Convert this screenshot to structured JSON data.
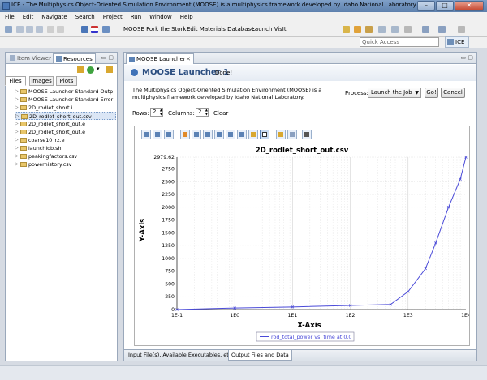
{
  "window": {
    "title": "ICE - The Multiphysics Object-Oriented Simulation Environment (MOOSE) is a multiphysics framework developed by Idaho National Laboratory. - ICE"
  },
  "menu": [
    "File",
    "Edit",
    "Navigate",
    "Search",
    "Project",
    "Run",
    "Window",
    "Help"
  ],
  "toolbar": {
    "link1": "MOOSE Fork the Stork",
    "link2": "Edit Materials Database",
    "link3": "Launch VisIt"
  },
  "quick_access": {
    "placeholder": "Quick Access"
  },
  "perspective": {
    "label": "ICE"
  },
  "left": {
    "tabs": [
      "Item Viewer",
      "Resources"
    ],
    "subtabs": [
      "Files",
      "Images",
      "Plots"
    ],
    "files": [
      "MOOSE Launcher Standard Outp",
      "MOOSE Launcher Standard Error",
      "2D_rodlet_short.i",
      "2D_rodlet_short_out.csv",
      "2D_rodlet_short_out.e",
      "2D_rodlet_short_out.e",
      "coarse10_rz.e",
      "launchlob.sh",
      "peakingfactors.csv",
      "powerhistory.csv"
    ]
  },
  "editor": {
    "tab": "MOOSE Launcher",
    "title": "MOOSE Launcher 1",
    "status": "Done!",
    "description": "The Multiphysics Object-Oriented Simulation Environment (MOOSE) is a multiphysics framework developed by Idaho National Laboratory.",
    "process_label": "Process:",
    "process_value": "Launch the Job",
    "go": "Go!",
    "cancel": "Cancel",
    "rows_label": "Rows:",
    "rows_value": "2",
    "cols_label": "Columns:",
    "cols_value": "2",
    "clear": "Clear",
    "bottom_tabs": [
      "Input File(s), Available Executables, etc.",
      "Output Files and Data"
    ]
  },
  "chart_data": {
    "type": "line",
    "title": "2D_rodlet_short_out.csv",
    "xlabel": "X-Axis",
    "ylabel": "Y-Axis",
    "x_scale": "log",
    "xlim": [
      0.1,
      10000
    ],
    "ylim": [
      0,
      2979.62
    ],
    "x_ticks": [
      "1E-1",
      "1E0",
      "1E1",
      "1E2",
      "1E3",
      "1E4"
    ],
    "y_ticks": [
      "0",
      "250",
      "500",
      "750",
      "1000",
      "1250",
      "1500",
      "1750",
      "2000",
      "2250",
      "2500",
      "2750",
      "2979.62"
    ],
    "grid": true,
    "legend_position": "bottom",
    "series": [
      {
        "name": "rod_total_power vs. time at 0.0",
        "color": "#4a4ad8",
        "x": [
          0.1,
          1,
          10,
          100,
          500,
          1000,
          2000,
          3000,
          5000,
          8000,
          10000
        ],
        "y": [
          0,
          30,
          50,
          80,
          100,
          350,
          800,
          1300,
          2000,
          2550,
          2979.62
        ]
      }
    ]
  }
}
